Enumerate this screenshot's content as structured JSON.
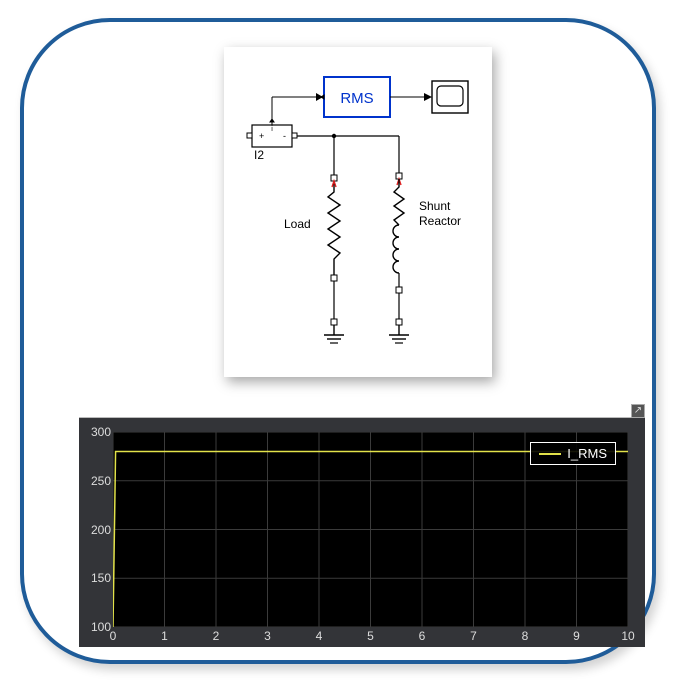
{
  "diagram": {
    "rms_block_label": "RMS",
    "sensor_label": "I2",
    "load_label": "Load",
    "shunt_label_line1": "Shunt",
    "shunt_label_line2": "Reactor"
  },
  "scope": {
    "legend_label": "I_RMS",
    "y_ticks": [
      "300",
      "250",
      "200",
      "150",
      "100"
    ],
    "x_ticks": [
      "0",
      "1",
      "2",
      "3",
      "4",
      "5",
      "6",
      "7",
      "8",
      "9",
      "10"
    ],
    "colors": {
      "trace": "#e2e24a",
      "grid": "#3b3b3b",
      "axis_text": "#dddddd"
    }
  },
  "chart_data": {
    "type": "line",
    "title": "",
    "xlabel": "",
    "ylabel": "",
    "xlim": [
      0,
      10
    ],
    "ylim": [
      100,
      300
    ],
    "x": [
      0,
      0.05,
      10
    ],
    "series": [
      {
        "name": "I_RMS",
        "values": [
          100,
          280,
          280
        ],
        "color": "#e2e24a"
      }
    ],
    "legend_position": "top-right",
    "grid": true
  }
}
